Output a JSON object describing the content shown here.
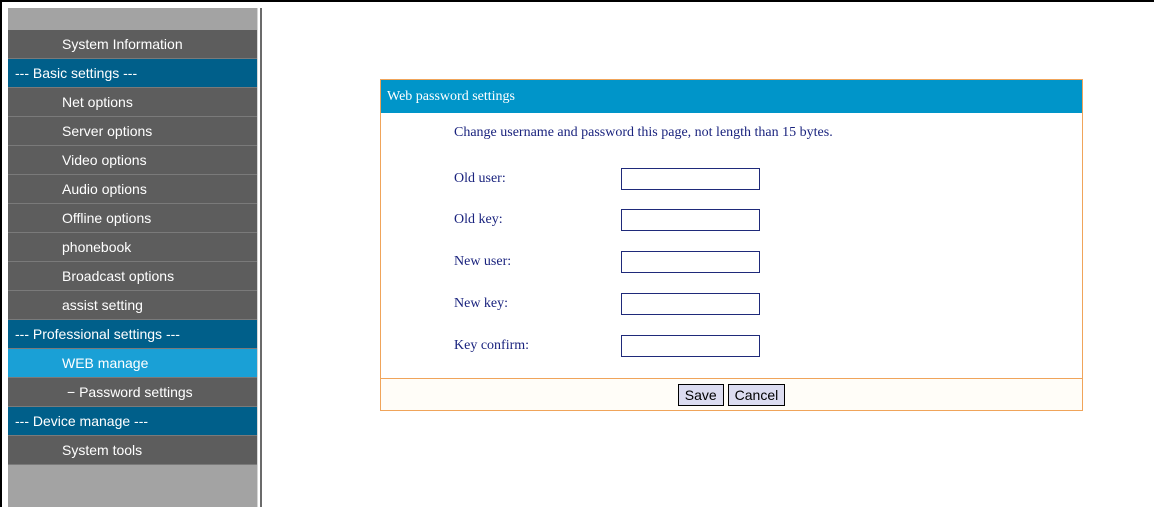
{
  "sidebar": {
    "items": [
      {
        "label": "System Information",
        "kind": "item"
      },
      {
        "label": "--- Basic settings ---",
        "kind": "section"
      },
      {
        "label": "Net options",
        "kind": "item"
      },
      {
        "label": "Server options",
        "kind": "item"
      },
      {
        "label": "Video options",
        "kind": "item"
      },
      {
        "label": "Audio options",
        "kind": "item"
      },
      {
        "label": "Offline options",
        "kind": "item"
      },
      {
        "label": "phonebook",
        "kind": "item"
      },
      {
        "label": "Broadcast options",
        "kind": "item"
      },
      {
        "label": "assist setting",
        "kind": "item"
      },
      {
        "label": "--- Professional settings ---",
        "kind": "section"
      },
      {
        "label": "WEB manage",
        "kind": "active"
      },
      {
        "label": "− Password settings",
        "kind": "sub"
      },
      {
        "label": "--- Device manage ---",
        "kind": "section"
      },
      {
        "label": "System tools",
        "kind": "item"
      }
    ]
  },
  "panel": {
    "title": "Web password settings",
    "intro": "Change username and password this page, not length than 15 bytes.",
    "fields": [
      {
        "label": "Old user:",
        "value": ""
      },
      {
        "label": "Old key:",
        "value": ""
      },
      {
        "label": "New user:",
        "value": ""
      },
      {
        "label": "New key:",
        "value": ""
      },
      {
        "label": "Key confirm:",
        "value": ""
      }
    ],
    "save_label": "Save",
    "cancel_label": "Cancel"
  },
  "colors": {
    "menu_item_bg": "#5d5d5d",
    "menu_section_bg": "#005f8a",
    "menu_active_bg": "#1aa0d6",
    "panel_header_bg": "#0095c9",
    "panel_border": "#f0a45a",
    "label_text": "#1a237e"
  }
}
